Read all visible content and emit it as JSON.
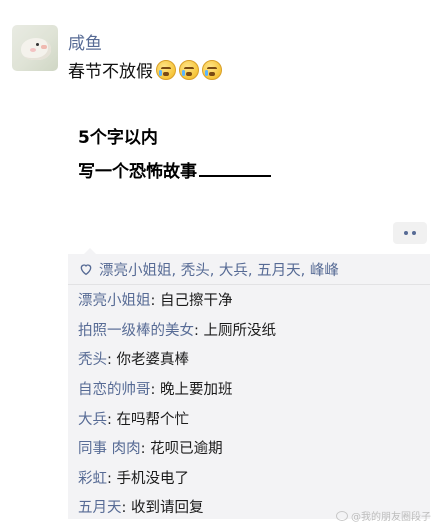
{
  "post": {
    "author": "咸鱼",
    "text": "春节不放假",
    "emojis": [
      "crying-emoji",
      "crying-emoji",
      "crying-emoji"
    ],
    "image_lines": [
      "5个字以内",
      "写一个恐怖故事"
    ]
  },
  "likes": {
    "names": "漂亮小姐姐, 秃头, 大兵, 五月天, 峰峰"
  },
  "comments": [
    {
      "author": "漂亮小姐姐",
      "text": ": 自己擦干净"
    },
    {
      "author": "拍照一级棒的美女",
      "text": ": 上厕所没纸"
    },
    {
      "author": "秃头",
      "text": ": 你老婆真棒"
    },
    {
      "author": "自恋的帅哥",
      "text": ": 晚上要加班"
    },
    {
      "author": "大兵",
      "text": ": 在吗帮个忙"
    },
    {
      "author": "同事 肉肉",
      "text": ": 花呗已逾期"
    },
    {
      "author": "彩虹",
      "text": ": 手机没电了"
    },
    {
      "author": "五月天",
      "text": ": 收到请回复"
    }
  ],
  "colors": {
    "link": "#576b95",
    "comment_bg": "#f3f3f5"
  },
  "watermark": "@我的朋友圈段子"
}
